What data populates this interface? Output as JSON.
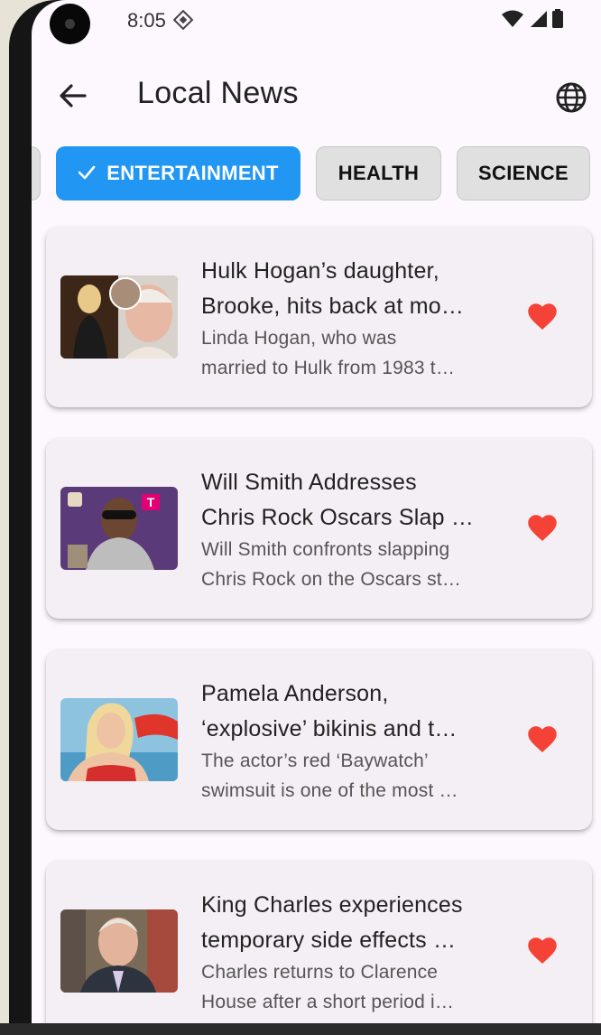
{
  "status_bar": {
    "time": "8:05"
  },
  "app_bar": {
    "title": "Local News"
  },
  "categories": [
    {
      "label": "",
      "selected": false
    },
    {
      "label": "ENTERTAINMENT",
      "selected": true
    },
    {
      "label": "HEALTH",
      "selected": false
    },
    {
      "label": "SCIENCE",
      "selected": false
    }
  ],
  "articles": [
    {
      "title_lines": [
        "Hulk Hogan’s daughter,",
        "Brooke, hits back at mo…"
      ],
      "desc_lines": [
        "Linda Hogan, who was",
        "married to Hulk from 1983 t…"
      ],
      "favorite": true
    },
    {
      "title_lines": [
        "Will Smith Addresses",
        "Chris Rock Oscars Slap …"
      ],
      "desc_lines": [
        "Will Smith confronts slapping",
        "Chris Rock on the Oscars st…"
      ],
      "favorite": true
    },
    {
      "title_lines": [
        "Pamela Anderson,",
        "‘explosive’ bikinis and t…"
      ],
      "desc_lines": [
        "The actor’s red ‘Baywatch’",
        "swimsuit is one of the most …"
      ],
      "favorite": true
    },
    {
      "title_lines": [
        "King Charles experiences",
        "temporary side effects …"
      ],
      "desc_lines": [
        "Charles returns to Clarence",
        "House after a short period i…"
      ],
      "favorite": true
    }
  ],
  "colors": {
    "accent": "#2196f3",
    "heart": "#f44336",
    "screen_bg": "#fcf8fd",
    "card_bg": "#f4eff4"
  },
  "icons": {
    "back": "arrow-left-icon",
    "language": "globe-icon",
    "chip_check": "check-icon",
    "favorite": "heart-icon"
  }
}
